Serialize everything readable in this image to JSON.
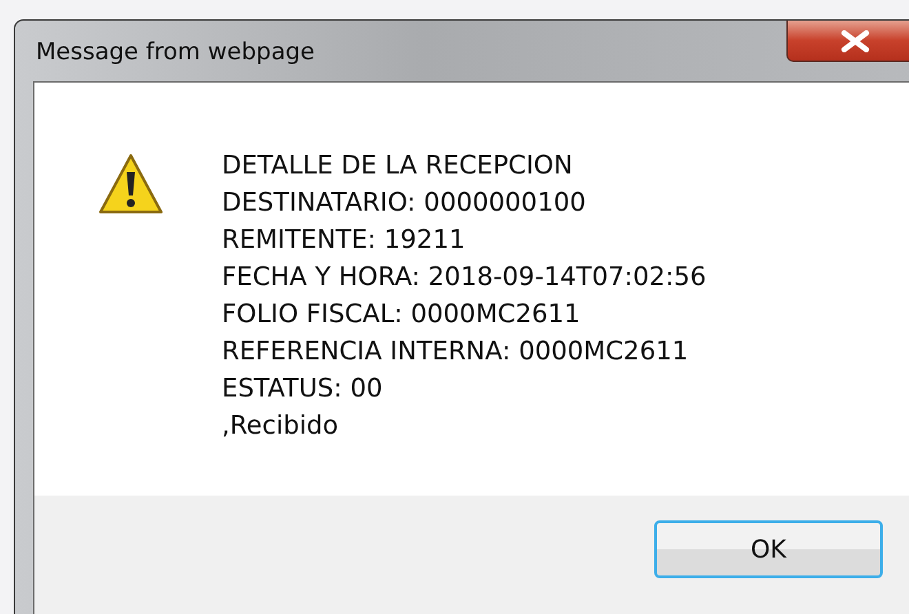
{
  "window": {
    "title": "Message from webpage"
  },
  "message": {
    "lines": [
      "DETALLE DE LA RECEPCION",
      "DESTINATARIO: 0000000100",
      "REMITENTE: 19211",
      "FECHA Y HORA: 2018-09-14T07:02:56",
      "FOLIO FISCAL: 0000MC2611",
      "REFERENCIA INTERNA: 0000MC2611",
      "ESTATUS: 00",
      ",Recibido"
    ]
  },
  "buttons": [
    {
      "label": "OK",
      "focused": true
    }
  ]
}
